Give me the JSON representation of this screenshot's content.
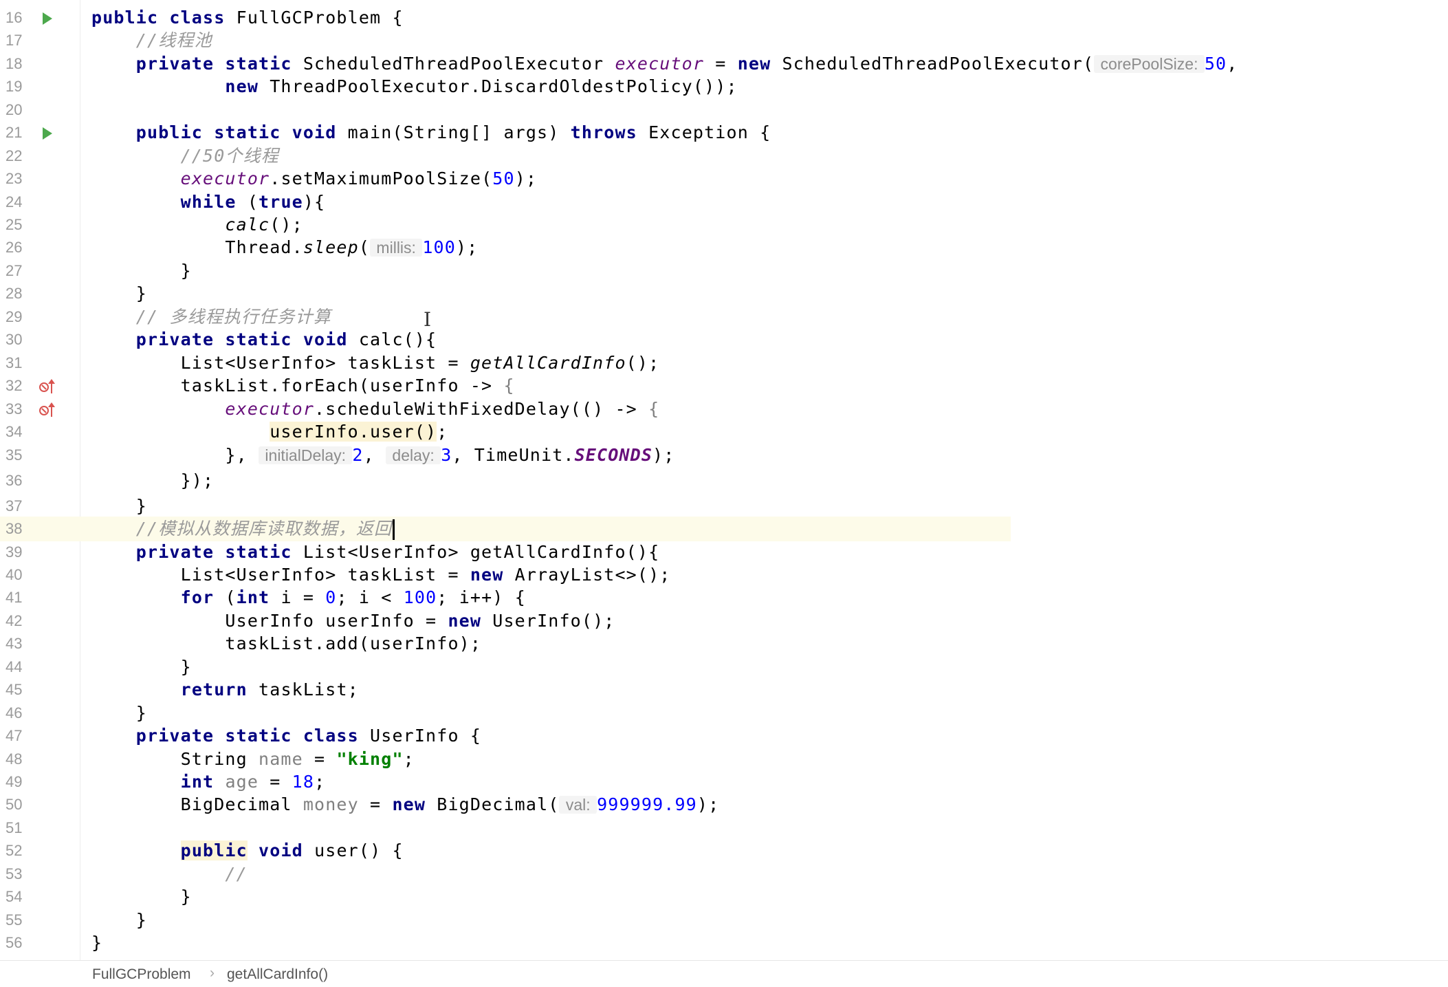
{
  "editor": {
    "file_class": "FullGCProblem",
    "lines": [
      {
        "n": "16",
        "parts": [
          [
            "public class ",
            "kw"
          ],
          [
            "FullGCProblem",
            ""
          ],
          [
            " {",
            ""
          ]
        ]
      },
      {
        "n": "17",
        "parts": [
          [
            "    //线程池",
            "cm"
          ]
        ]
      },
      {
        "n": "18",
        "parts": [
          [
            "    private static ",
            "kw"
          ],
          [
            "ScheduledThreadPoolExecutor ",
            ""
          ],
          [
            "executor",
            "fld"
          ],
          [
            " = ",
            ""
          ],
          [
            "new ",
            "kw"
          ],
          [
            "ScheduledThreadPoolExecutor(",
            ""
          ],
          [
            " corePoolSize: ",
            "hint"
          ],
          [
            "50",
            "num"
          ],
          [
            ",",
            ""
          ]
        ]
      },
      {
        "n": "19",
        "parts": [
          [
            "            new ",
            "kw"
          ],
          [
            "ThreadPoolExecutor.DiscardOldestPolicy());",
            ""
          ]
        ]
      },
      {
        "n": "20",
        "parts": []
      },
      {
        "n": "21",
        "parts": [
          [
            "    public static void ",
            "kw"
          ],
          [
            "main(String[] args) ",
            ""
          ],
          [
            "throws ",
            "kw"
          ],
          [
            "Exception {",
            ""
          ]
        ]
      },
      {
        "n": "22",
        "parts": [
          [
            "        //50个线程",
            "cm"
          ]
        ]
      },
      {
        "n": "23",
        "parts": [
          [
            "        ",
            ""
          ],
          [
            "executor",
            "fld"
          ],
          [
            ".setMaximumPoolSize(",
            ""
          ],
          [
            "50",
            "num"
          ],
          [
            ");",
            ""
          ]
        ]
      },
      {
        "n": "24",
        "parts": [
          [
            "        ",
            ""
          ],
          [
            "while",
            "kw"
          ],
          [
            " (",
            ""
          ],
          [
            "true",
            "kw"
          ],
          [
            "){",
            ""
          ]
        ]
      },
      {
        "n": "25",
        "parts": [
          [
            "            ",
            ""
          ],
          [
            "calc",
            "it"
          ],
          [
            "();",
            ""
          ]
        ]
      },
      {
        "n": "26",
        "parts": [
          [
            "            Thread.",
            ""
          ],
          [
            "sleep",
            "it"
          ],
          [
            "(",
            ""
          ],
          [
            " millis: ",
            "hint"
          ],
          [
            "100",
            "num"
          ],
          [
            ");",
            ""
          ]
        ]
      },
      {
        "n": "27",
        "parts": [
          [
            "        }",
            ""
          ]
        ]
      },
      {
        "n": "28",
        "parts": [
          [
            "    }",
            ""
          ]
        ]
      },
      {
        "n": "29",
        "parts": [
          [
            "    // 多线程执行任务计算",
            "cm"
          ]
        ]
      },
      {
        "n": "30",
        "parts": [
          [
            "    private static void ",
            "kw"
          ],
          [
            "calc(){",
            ""
          ]
        ]
      },
      {
        "n": "31",
        "parts": [
          [
            "        List<UserInfo> taskList = ",
            ""
          ],
          [
            "getAllCardInfo",
            "it"
          ],
          [
            "();",
            ""
          ]
        ]
      },
      {
        "n": "32",
        "parts": [
          [
            "        taskList.forEach(userInfo -> ",
            ""
          ],
          [
            "{",
            "unused"
          ]
        ]
      },
      {
        "n": "33",
        "parts": [
          [
            "            ",
            ""
          ],
          [
            "executor",
            "fld"
          ],
          [
            ".scheduleWithFixedDelay(() -> ",
            ""
          ],
          [
            "{",
            "unused"
          ]
        ]
      },
      {
        "n": "34",
        "parts": [
          [
            "                ",
            ""
          ],
          [
            "userInfo.user()",
            "hl-call"
          ],
          [
            ";",
            ""
          ]
        ]
      },
      {
        "n": "35",
        "parts": [
          [
            "            }, ",
            ""
          ],
          [
            " initialDelay: ",
            "hint"
          ],
          [
            "2",
            "num"
          ],
          [
            ", ",
            ""
          ],
          [
            " delay: ",
            "hint"
          ],
          [
            "3",
            "num"
          ],
          [
            ", TimeUnit.",
            ""
          ],
          [
            "SECONDS",
            "const"
          ],
          [
            ");",
            ""
          ]
        ]
      },
      {
        "n": "36",
        "parts": [
          [
            "        });",
            ""
          ]
        ]
      },
      {
        "n": "37",
        "parts": [
          [
            "    }",
            ""
          ]
        ]
      },
      {
        "n": "38",
        "parts": [
          [
            "    //模拟从数据库读取数据，返回",
            "cm"
          ]
        ]
      },
      {
        "n": "39",
        "parts": [
          [
            "    private static ",
            "kw"
          ],
          [
            "List<UserInfo> getAllCardInfo(){",
            ""
          ]
        ]
      },
      {
        "n": "40",
        "parts": [
          [
            "        List<UserInfo> taskList = ",
            ""
          ],
          [
            "new ",
            "kw"
          ],
          [
            "ArrayList<>();",
            ""
          ]
        ]
      },
      {
        "n": "41",
        "parts": [
          [
            "        ",
            ""
          ],
          [
            "for ",
            "kw"
          ],
          [
            "(",
            ""
          ],
          [
            "int ",
            "kw"
          ],
          [
            "i = ",
            ""
          ],
          [
            "0",
            "num"
          ],
          [
            "; i < ",
            ""
          ],
          [
            "100",
            "num"
          ],
          [
            "; i++) {",
            ""
          ]
        ]
      },
      {
        "n": "42",
        "parts": [
          [
            "            UserInfo userInfo = ",
            ""
          ],
          [
            "new ",
            "kw"
          ],
          [
            "UserInfo();",
            ""
          ]
        ]
      },
      {
        "n": "43",
        "parts": [
          [
            "            taskList.add(userInfo);",
            ""
          ]
        ]
      },
      {
        "n": "44",
        "parts": [
          [
            "        }",
            ""
          ]
        ]
      },
      {
        "n": "45",
        "parts": [
          [
            "        ",
            ""
          ],
          [
            "return ",
            "kw"
          ],
          [
            "taskList;",
            ""
          ]
        ]
      },
      {
        "n": "46",
        "parts": [
          [
            "    }",
            ""
          ]
        ]
      },
      {
        "n": "47",
        "parts": [
          [
            "    private static class ",
            "kw"
          ],
          [
            "UserInfo {",
            ""
          ]
        ]
      },
      {
        "n": "48",
        "parts": [
          [
            "        String ",
            ""
          ],
          [
            "name",
            "unused"
          ],
          [
            " = ",
            ""
          ],
          [
            "\"king\"",
            "str"
          ],
          [
            ";",
            ""
          ]
        ]
      },
      {
        "n": "49",
        "parts": [
          [
            "        ",
            ""
          ],
          [
            "int ",
            "kw"
          ],
          [
            "age",
            "unused"
          ],
          [
            " = ",
            ""
          ],
          [
            "18",
            "num"
          ],
          [
            ";",
            ""
          ]
        ]
      },
      {
        "n": "50",
        "parts": [
          [
            "        BigDecimal ",
            ""
          ],
          [
            "money",
            "unused"
          ],
          [
            " = ",
            ""
          ],
          [
            "new ",
            "kw"
          ],
          [
            "BigDecimal(",
            ""
          ],
          [
            " val: ",
            "hint"
          ],
          [
            "999999.99",
            "num"
          ],
          [
            ");",
            ""
          ]
        ]
      },
      {
        "n": "51",
        "parts": []
      },
      {
        "n": "52",
        "parts": [
          [
            "        ",
            ""
          ],
          [
            "public",
            "pub-hl kw"
          ],
          [
            " void ",
            "kw"
          ],
          [
            "user() {",
            ""
          ]
        ]
      },
      {
        "n": "53",
        "parts": [
          [
            "            //",
            "cm"
          ]
        ]
      },
      {
        "n": "54",
        "parts": [
          [
            "        }",
            ""
          ]
        ]
      },
      {
        "n": "55",
        "parts": [
          [
            "    }",
            ""
          ]
        ]
      },
      {
        "n": "56",
        "parts": [
          [
            "}",
            ""
          ]
        ]
      }
    ],
    "markers": {
      "16": "run-icon",
      "21": "run-icon",
      "32": "override-icon",
      "33": "override-icon"
    }
  },
  "breadcrumb": {
    "items": [
      "FullGCProblem",
      "getAllCardInfo()"
    ]
  },
  "colors": {
    "keyword": "#000080",
    "field": "#660e7a",
    "number": "#0000ff",
    "string": "#008000",
    "comment": "#9a9a9a",
    "run_marker": "#4ca84c",
    "override_marker": "#d9534f"
  }
}
